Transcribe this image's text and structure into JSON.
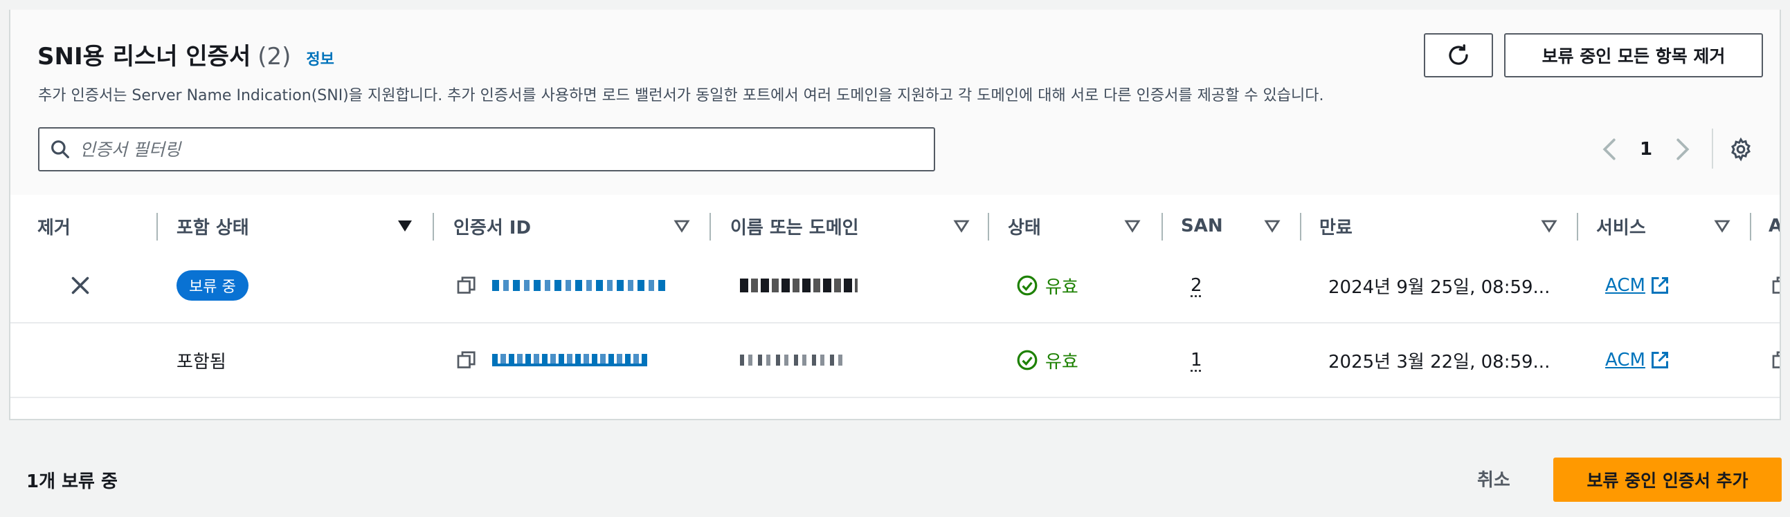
{
  "panel": {
    "title": "SNI용 리스너 인증서",
    "count": "(2)",
    "info_link": "정보",
    "description": "추가 인증서는 Server Name Indication(SNI)을 지원합니다. 추가 인증서를 사용하면 로드 밸런서가 동일한 포트에서 여러 도메인을 지원하고 각 도메인에 대해 서로 다른 인증서를 제공할 수 있습니다.",
    "refresh_icon": "refresh-icon",
    "remove_all_label": "보류 중인 모든 항목 제거",
    "search": {
      "placeholder": "인증서 필터링",
      "icon": "search-icon"
    },
    "pagination": {
      "current_page": "1",
      "prev_icon": "chevron-left-icon",
      "next_icon": "chevron-right-icon"
    },
    "settings_icon": "gear-icon"
  },
  "table": {
    "columns": [
      {
        "label": "제거"
      },
      {
        "label": "포함 상태",
        "sort": "sorted-descending"
      },
      {
        "label": "인증서 ID",
        "sort": "sortable"
      },
      {
        "label": "이름 또는 도메인",
        "sort": "sortable"
      },
      {
        "label": "상태",
        "sort": "sortable"
      },
      {
        "label": "SAN",
        "sort": "sortable"
      },
      {
        "label": "만료",
        "sort": "sortable"
      },
      {
        "label": "서비스",
        "sort": "sortable"
      },
      {
        "label": "A"
      }
    ],
    "rows": [
      {
        "remove_icon": "close-icon",
        "inclusion": "보류 중",
        "inclusion_badge": true,
        "status": "유효",
        "san": "2",
        "expires": "2024년 9월 25일, 08:59...",
        "service": "ACM"
      },
      {
        "remove_icon": "",
        "inclusion": "포함됨",
        "inclusion_badge": false,
        "status": "유효",
        "san": "1",
        "expires": "2025년 3월 22일, 08:59...",
        "service": "ACM"
      }
    ]
  },
  "footer": {
    "pending_count": "1개 보류 중",
    "cancel_label": "취소",
    "add_label": "보류 중인 인증서 추가"
  },
  "colors": {
    "primary_button": "#ff9900",
    "link": "#0073bb",
    "badge": "#0972d3",
    "success": "#1d8102"
  }
}
